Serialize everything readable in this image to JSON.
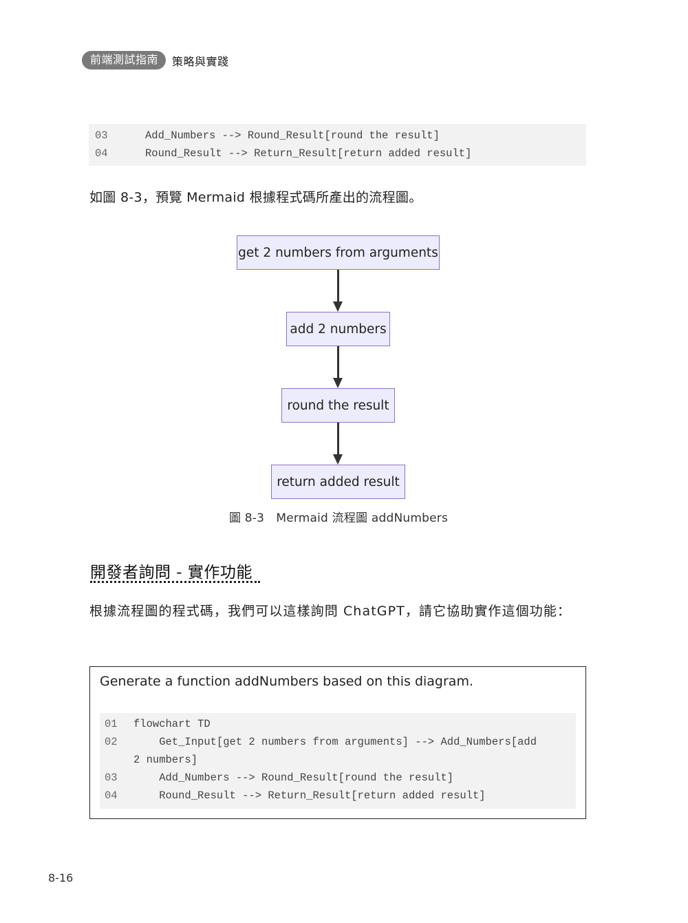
{
  "header": {
    "book_title": "前端測試指南",
    "book_subtitle": "策略與實踐"
  },
  "top_code": {
    "lines": [
      {
        "num": "03",
        "text": "Add_Numbers --> Round_Result[round the result]"
      },
      {
        "num": "04",
        "text": "Round_Result --> Return_Result[return added result]"
      }
    ]
  },
  "intro_paragraph": "如圖 8-3，預覽 Mermaid 根據程式碼所產出的流程圖。",
  "flowchart": {
    "direction": "TD",
    "colors": {
      "node_fill": "#ececfc",
      "node_border": "#9070c8",
      "edge": "#333333"
    },
    "nodes": [
      {
        "id": "Get_Input",
        "label": "get 2 numbers from arguments"
      },
      {
        "id": "Add_Numbers",
        "label": "add 2 numbers"
      },
      {
        "id": "Round_Result",
        "label": "round the result"
      },
      {
        "id": "Return_Result",
        "label": "return added result"
      }
    ],
    "edges": [
      {
        "from": "Get_Input",
        "to": "Add_Numbers"
      },
      {
        "from": "Add_Numbers",
        "to": "Round_Result"
      },
      {
        "from": "Round_Result",
        "to": "Return_Result"
      }
    ],
    "caption": "圖 8-3　Mermaid 流程圖 addNumbers"
  },
  "section": {
    "heading": "開發者詢問 - 實作功能",
    "body": "根據流程圖的程式碼，我們可以這樣詢問 ChatGPT，請它協助實作這個功能："
  },
  "prompt_box": {
    "prompt": "Generate a function addNumbers based on this diagram.",
    "code_lines": [
      {
        "num": "01",
        "text": "flowchart TD"
      },
      {
        "num": "02",
        "text": "    Get_Input[get 2 numbers from arguments] --> Add_Numbers[add",
        "continuation": "2 numbers]"
      },
      {
        "num": "03",
        "text": "    Add_Numbers --> Round_Result[round the result]"
      },
      {
        "num": "04",
        "text": "    Round_Result --> Return_Result[return added result]"
      }
    ]
  },
  "footer": {
    "page_number": "8-16"
  }
}
